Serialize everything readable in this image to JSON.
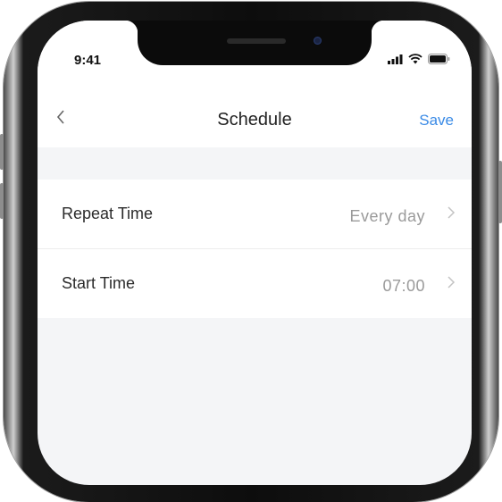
{
  "status_bar": {
    "time": "9:41",
    "icons": [
      "signal-icon",
      "wifi-icon",
      "battery-icon"
    ]
  },
  "nav": {
    "back_icon": "chevron-left-icon",
    "title": "Schedule",
    "save_label": "Save"
  },
  "settings": [
    {
      "label": "Repeat Time",
      "value": "Every day",
      "icon": "chevron-right-icon"
    },
    {
      "label": "Start Time",
      "value": "07:00",
      "icon": "chevron-right-icon"
    }
  ],
  "colors": {
    "accent": "#3b8be6",
    "background": "#f4f5f7",
    "frame": "#0d0d0d"
  }
}
